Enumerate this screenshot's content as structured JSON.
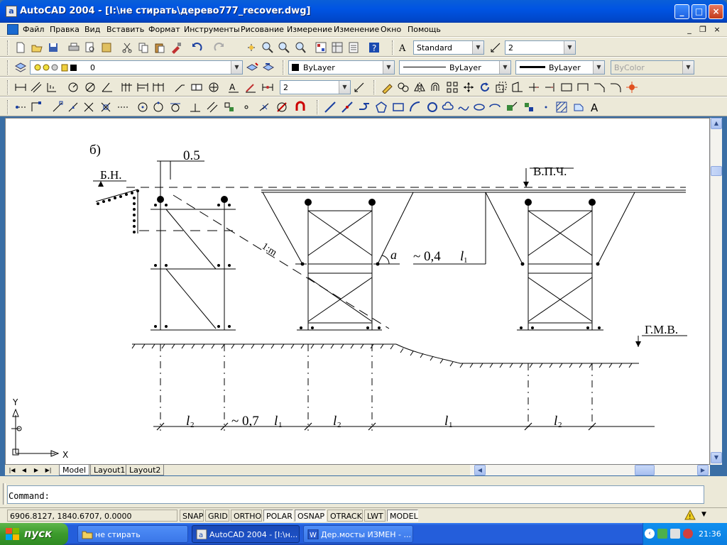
{
  "window": {
    "title": "AutoCAD 2004 - [I:\\не стирать\\дерево777_recover.dwg]",
    "app_icon": "a",
    "controls": {
      "minimize": "_",
      "maximize": "□",
      "close": "×"
    }
  },
  "menubar": {
    "items": [
      "Файл",
      "Правка",
      "Вид",
      "Вставить",
      "Формат",
      "Инструменты",
      "Рисование",
      "Измерение",
      "Изменение",
      "Окно",
      "Помощь"
    ],
    "doc_controls": {
      "minimize": "_",
      "restore": "❐",
      "close": "×"
    }
  },
  "toolbars": {
    "text_style": "Standard",
    "dim_scale": "2",
    "layer": "0",
    "color": "ByLayer",
    "linetype": "ByLayer",
    "lineweight": "ByLayer",
    "plot_style": "ByColor",
    "dim_style_value": "2"
  },
  "drawing": {
    "label_b": "б)",
    "dim_0_5": "0.5",
    "label_bn": "Б.Н.",
    "label_vpch": "В.П.Ч.",
    "label_gmv": "Г.М.В.",
    "slope": "1:m",
    "angle_a": "a",
    "approx_04": "~ 0,4",
    "approx_07": "~ 0,7",
    "l_letter": "l",
    "sub_1": "1",
    "sub_2": "2",
    "ucs_y": "Y",
    "ucs_x": "X"
  },
  "layout_tabs": [
    "Model",
    "Layout1",
    "Layout2"
  ],
  "active_tab": "Model",
  "command": {
    "prompt": "Command:"
  },
  "statusbar": {
    "coords": "6906.8127, 1840.6707, 0.0000",
    "buttons": [
      {
        "label": "SNAP",
        "on": false
      },
      {
        "label": "GRID",
        "on": false
      },
      {
        "label": "ORTHO",
        "on": false
      },
      {
        "label": "POLAR",
        "on": true
      },
      {
        "label": "OSNAP",
        "on": true
      },
      {
        "label": "OTRACK",
        "on": false
      },
      {
        "label": "LWT",
        "on": false
      },
      {
        "label": "MODEL",
        "on": true
      }
    ]
  },
  "taskbar": {
    "start": "пуск",
    "tasks": [
      {
        "label": "не стирать",
        "active": false
      },
      {
        "label": "AutoCAD 2004 - [I:\\н...",
        "active": true
      },
      {
        "label": "Дер.мосты ИЗМЕН - ...",
        "active": false
      }
    ],
    "clock": "21:36"
  },
  "colors": {
    "titlebar": "#0054e3",
    "desktop_chrome": "#ece9d8",
    "taskbar": "#245edb",
    "start": "#3c9a2c"
  }
}
